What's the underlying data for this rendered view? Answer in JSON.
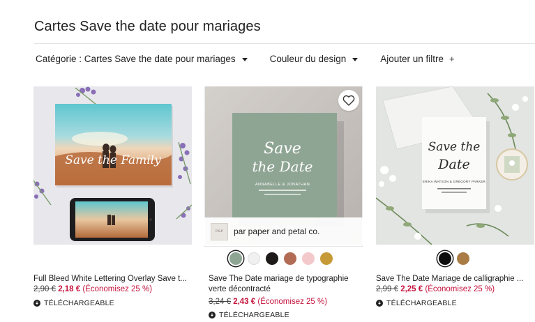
{
  "page": {
    "title": "Cartes Save the date pour mariages"
  },
  "filters": {
    "category": "Catégorie : Cartes Save the date pour mariages",
    "design_color": "Couleur du design",
    "add_filter": "Ajouter un filtre",
    "add_filter_icon": "+"
  },
  "products": [
    {
      "title": "Full Bleed White Lettering Overlay Save t...",
      "old_price": "2,90 €",
      "new_price": "2,18 €",
      "discount": "(Économisez 25 %)",
      "badge": "TÉLÉCHARGEABLE",
      "image_text": "Save the Family"
    },
    {
      "title_line1": "Save The Date mariage de typographie",
      "title_line2": "verte décontracté",
      "old_price": "3,24 €",
      "new_price": "2,43 €",
      "discount": "(Économisez 25 %)",
      "badge": "TÉLÉCHARGEABLE",
      "seller": "par paper and petal co.",
      "seller_logo": "P&P",
      "image_script_1": "Save",
      "image_script_2": "the Date",
      "image_names": "ANNABELLE & JONATHAN",
      "swatches": [
        "#8fa594",
        "#f0f0f0",
        "#1f1a1a",
        "#b26b55",
        "#f3c9cb",
        "#c79a38"
      ]
    },
    {
      "title": "Save The Date Mariage de calligraphie ...",
      "old_price": "2,99 €",
      "new_price": "2,25 €",
      "discount": "(Économisez 25 %)",
      "badge": "TÉLÉCHARGEABLE",
      "image_script_1": "Save the",
      "image_script_2": "Date",
      "image_names": "ERIKA WATSON & GREGORY PARKER",
      "swatches": [
        "#0d0d0d",
        "#a97c46"
      ]
    }
  ],
  "colors": {
    "sale_red": "#c5123b",
    "text": "#222222"
  }
}
